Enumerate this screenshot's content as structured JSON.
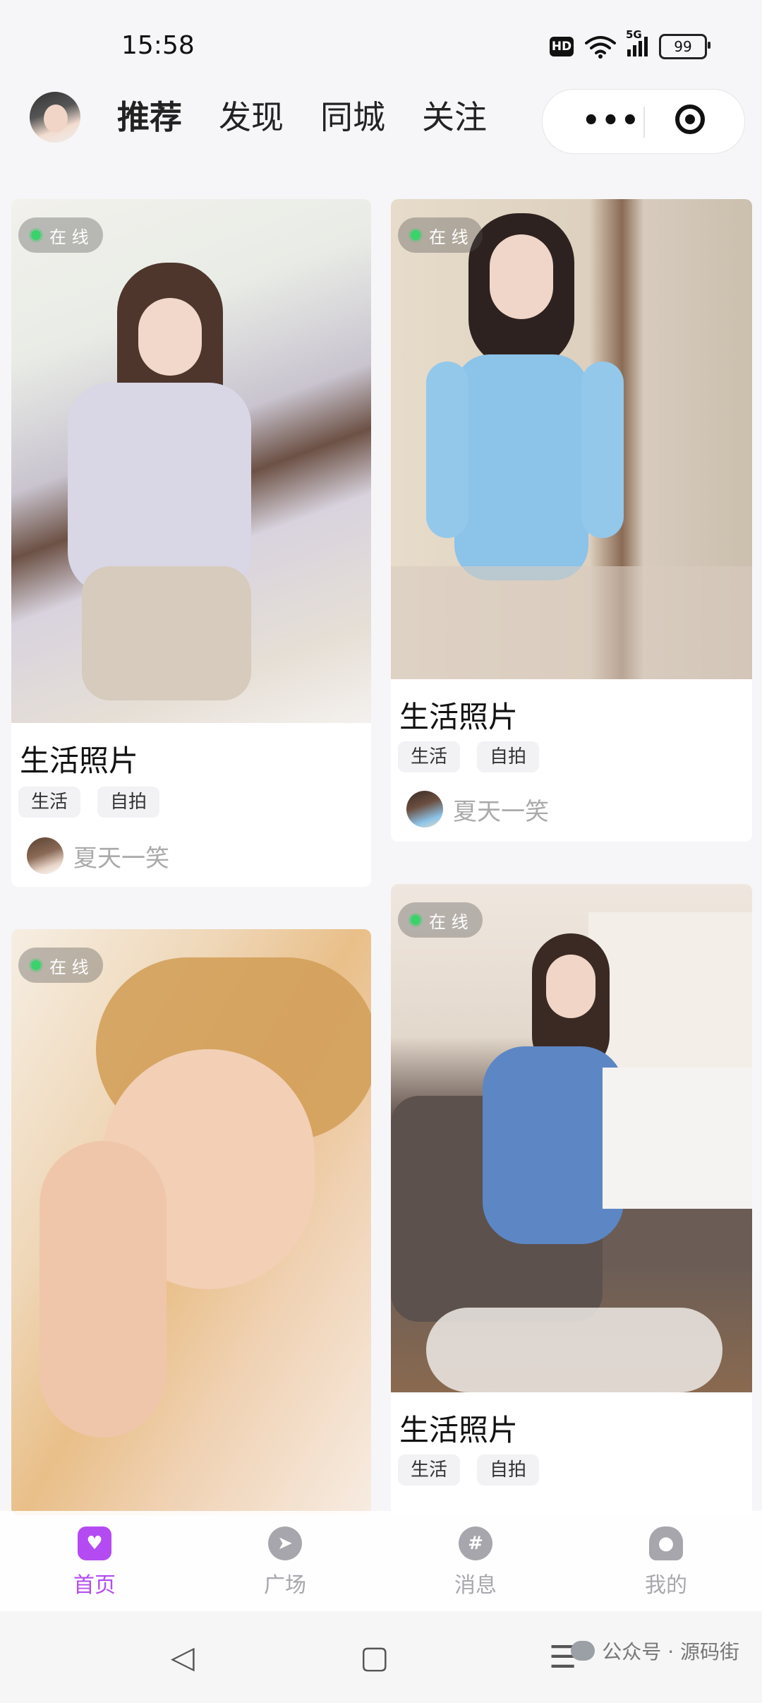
{
  "status_bar": {
    "time": "15:58",
    "hd": "HD",
    "network": "5G",
    "battery": "99"
  },
  "top_nav": {
    "tabs": [
      {
        "label": "推荐",
        "active": true
      },
      {
        "label": "发现",
        "active": false
      },
      {
        "label": "同城",
        "active": false
      },
      {
        "label": "关注",
        "active": false
      }
    ],
    "more_label": "•••"
  },
  "feed": {
    "cards": [
      {
        "online": "在 线",
        "title": "生活照片",
        "tags": [
          "生活",
          "自拍"
        ],
        "author": "夏天一笑",
        "photo_description": "girl in lavender cardigan on white bed"
      },
      {
        "online": "在 线",
        "title": "生活照片",
        "tags": [
          "生活",
          "自拍"
        ],
        "author": "夏天一笑",
        "photo_description": "girl in light blue off-shoulder dress"
      },
      {
        "online": "在 线",
        "photo_description": "warm-toned close-up portrait"
      },
      {
        "online": "在 线",
        "title": "生活照片",
        "tags": [
          "生活",
          "自拍"
        ],
        "photo_description": "girl in denim dress by lace table"
      }
    ]
  },
  "bottom_nav": {
    "items": [
      {
        "label": "首页",
        "icon": "home-heart-icon",
        "active": true
      },
      {
        "label": "广场",
        "icon": "compass-icon",
        "active": false
      },
      {
        "label": "消息",
        "icon": "hashtag-icon",
        "active": false
      },
      {
        "label": "我的",
        "icon": "person-icon",
        "active": false
      }
    ]
  },
  "system_nav": {
    "watermark": "公众号 · 源码街"
  },
  "colors": {
    "accent": "#b44bf2",
    "online": "#3ad26b"
  }
}
